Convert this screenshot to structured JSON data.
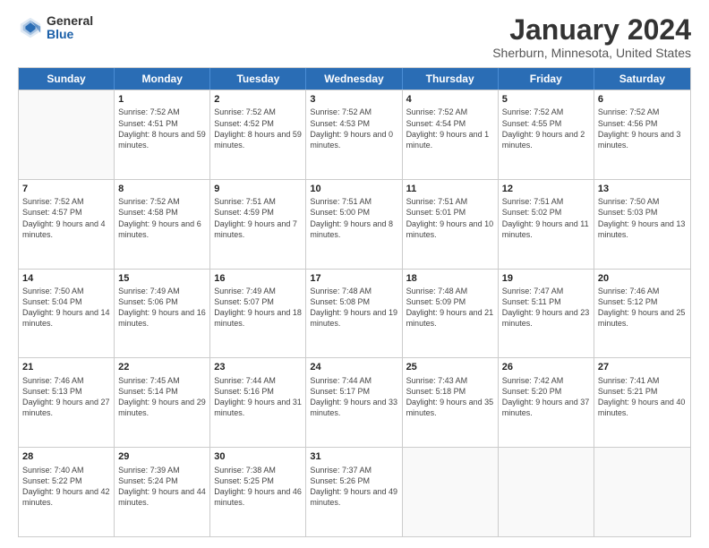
{
  "logo": {
    "general": "General",
    "blue": "Blue"
  },
  "header": {
    "title": "January 2024",
    "subtitle": "Sherburn, Minnesota, United States"
  },
  "weekdays": [
    "Sunday",
    "Monday",
    "Tuesday",
    "Wednesday",
    "Thursday",
    "Friday",
    "Saturday"
  ],
  "weeks": [
    [
      {
        "day": "",
        "empty": true
      },
      {
        "day": "1",
        "sunrise": "Sunrise: 7:52 AM",
        "sunset": "Sunset: 4:51 PM",
        "daylight": "Daylight: 8 hours and 59 minutes."
      },
      {
        "day": "2",
        "sunrise": "Sunrise: 7:52 AM",
        "sunset": "Sunset: 4:52 PM",
        "daylight": "Daylight: 8 hours and 59 minutes."
      },
      {
        "day": "3",
        "sunrise": "Sunrise: 7:52 AM",
        "sunset": "Sunset: 4:53 PM",
        "daylight": "Daylight: 9 hours and 0 minutes."
      },
      {
        "day": "4",
        "sunrise": "Sunrise: 7:52 AM",
        "sunset": "Sunset: 4:54 PM",
        "daylight": "Daylight: 9 hours and 1 minute."
      },
      {
        "day": "5",
        "sunrise": "Sunrise: 7:52 AM",
        "sunset": "Sunset: 4:55 PM",
        "daylight": "Daylight: 9 hours and 2 minutes."
      },
      {
        "day": "6",
        "sunrise": "Sunrise: 7:52 AM",
        "sunset": "Sunset: 4:56 PM",
        "daylight": "Daylight: 9 hours and 3 minutes."
      }
    ],
    [
      {
        "day": "7",
        "sunrise": "Sunrise: 7:52 AM",
        "sunset": "Sunset: 4:57 PM",
        "daylight": "Daylight: 9 hours and 4 minutes."
      },
      {
        "day": "8",
        "sunrise": "Sunrise: 7:52 AM",
        "sunset": "Sunset: 4:58 PM",
        "daylight": "Daylight: 9 hours and 6 minutes."
      },
      {
        "day": "9",
        "sunrise": "Sunrise: 7:51 AM",
        "sunset": "Sunset: 4:59 PM",
        "daylight": "Daylight: 9 hours and 7 minutes."
      },
      {
        "day": "10",
        "sunrise": "Sunrise: 7:51 AM",
        "sunset": "Sunset: 5:00 PM",
        "daylight": "Daylight: 9 hours and 8 minutes."
      },
      {
        "day": "11",
        "sunrise": "Sunrise: 7:51 AM",
        "sunset": "Sunset: 5:01 PM",
        "daylight": "Daylight: 9 hours and 10 minutes."
      },
      {
        "day": "12",
        "sunrise": "Sunrise: 7:51 AM",
        "sunset": "Sunset: 5:02 PM",
        "daylight": "Daylight: 9 hours and 11 minutes."
      },
      {
        "day": "13",
        "sunrise": "Sunrise: 7:50 AM",
        "sunset": "Sunset: 5:03 PM",
        "daylight": "Daylight: 9 hours and 13 minutes."
      }
    ],
    [
      {
        "day": "14",
        "sunrise": "Sunrise: 7:50 AM",
        "sunset": "Sunset: 5:04 PM",
        "daylight": "Daylight: 9 hours and 14 minutes."
      },
      {
        "day": "15",
        "sunrise": "Sunrise: 7:49 AM",
        "sunset": "Sunset: 5:06 PM",
        "daylight": "Daylight: 9 hours and 16 minutes."
      },
      {
        "day": "16",
        "sunrise": "Sunrise: 7:49 AM",
        "sunset": "Sunset: 5:07 PM",
        "daylight": "Daylight: 9 hours and 18 minutes."
      },
      {
        "day": "17",
        "sunrise": "Sunrise: 7:48 AM",
        "sunset": "Sunset: 5:08 PM",
        "daylight": "Daylight: 9 hours and 19 minutes."
      },
      {
        "day": "18",
        "sunrise": "Sunrise: 7:48 AM",
        "sunset": "Sunset: 5:09 PM",
        "daylight": "Daylight: 9 hours and 21 minutes."
      },
      {
        "day": "19",
        "sunrise": "Sunrise: 7:47 AM",
        "sunset": "Sunset: 5:11 PM",
        "daylight": "Daylight: 9 hours and 23 minutes."
      },
      {
        "day": "20",
        "sunrise": "Sunrise: 7:46 AM",
        "sunset": "Sunset: 5:12 PM",
        "daylight": "Daylight: 9 hours and 25 minutes."
      }
    ],
    [
      {
        "day": "21",
        "sunrise": "Sunrise: 7:46 AM",
        "sunset": "Sunset: 5:13 PM",
        "daylight": "Daylight: 9 hours and 27 minutes."
      },
      {
        "day": "22",
        "sunrise": "Sunrise: 7:45 AM",
        "sunset": "Sunset: 5:14 PM",
        "daylight": "Daylight: 9 hours and 29 minutes."
      },
      {
        "day": "23",
        "sunrise": "Sunrise: 7:44 AM",
        "sunset": "Sunset: 5:16 PM",
        "daylight": "Daylight: 9 hours and 31 minutes."
      },
      {
        "day": "24",
        "sunrise": "Sunrise: 7:44 AM",
        "sunset": "Sunset: 5:17 PM",
        "daylight": "Daylight: 9 hours and 33 minutes."
      },
      {
        "day": "25",
        "sunrise": "Sunrise: 7:43 AM",
        "sunset": "Sunset: 5:18 PM",
        "daylight": "Daylight: 9 hours and 35 minutes."
      },
      {
        "day": "26",
        "sunrise": "Sunrise: 7:42 AM",
        "sunset": "Sunset: 5:20 PM",
        "daylight": "Daylight: 9 hours and 37 minutes."
      },
      {
        "day": "27",
        "sunrise": "Sunrise: 7:41 AM",
        "sunset": "Sunset: 5:21 PM",
        "daylight": "Daylight: 9 hours and 40 minutes."
      }
    ],
    [
      {
        "day": "28",
        "sunrise": "Sunrise: 7:40 AM",
        "sunset": "Sunset: 5:22 PM",
        "daylight": "Daylight: 9 hours and 42 minutes."
      },
      {
        "day": "29",
        "sunrise": "Sunrise: 7:39 AM",
        "sunset": "Sunset: 5:24 PM",
        "daylight": "Daylight: 9 hours and 44 minutes."
      },
      {
        "day": "30",
        "sunrise": "Sunrise: 7:38 AM",
        "sunset": "Sunset: 5:25 PM",
        "daylight": "Daylight: 9 hours and 46 minutes."
      },
      {
        "day": "31",
        "sunrise": "Sunrise: 7:37 AM",
        "sunset": "Sunset: 5:26 PM",
        "daylight": "Daylight: 9 hours and 49 minutes."
      },
      {
        "day": "",
        "empty": true
      },
      {
        "day": "",
        "empty": true
      },
      {
        "day": "",
        "empty": true
      }
    ]
  ]
}
